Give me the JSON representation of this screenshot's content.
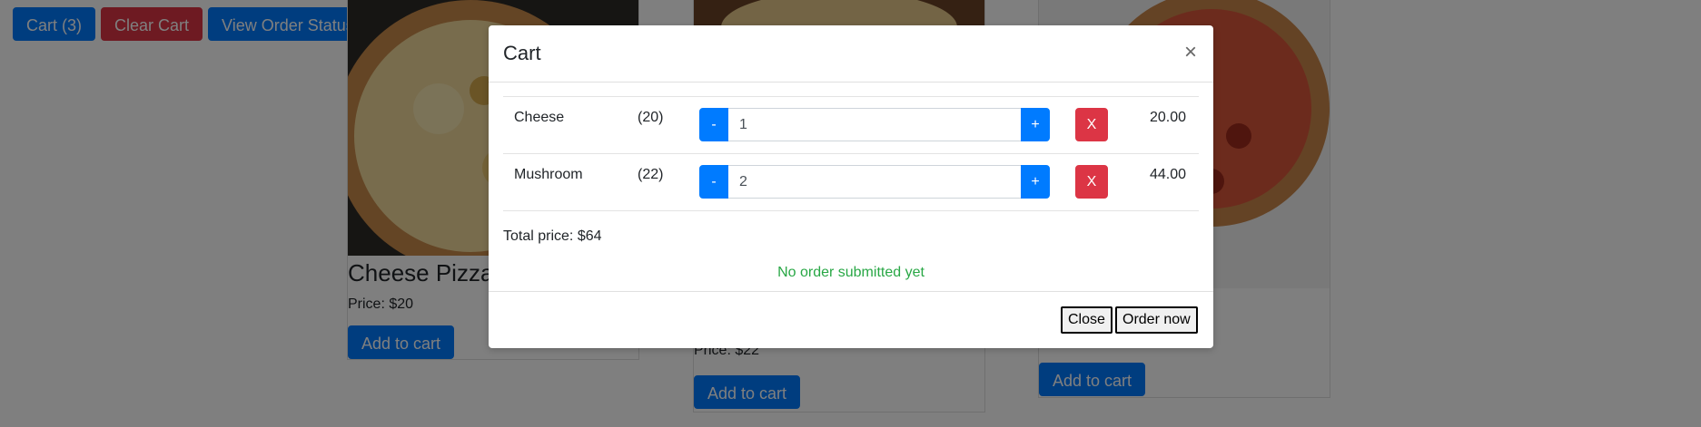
{
  "toolbar": {
    "cart_label": "Cart (3)",
    "clear_label": "Clear Cart",
    "status_label": "View Order Status"
  },
  "products": [
    {
      "title": "Cheese Pizza",
      "price": "Price: $20",
      "button": "Add to cart"
    },
    {
      "title": "",
      "price": "Price: $22",
      "button": "Add to cart"
    },
    {
      "title": "",
      "price": "",
      "button": "Add to cart"
    }
  ],
  "modal": {
    "title": "Cart",
    "close_glyph": "×",
    "items": [
      {
        "name": "Cheese",
        "unit_price": "(20)",
        "quantity": "1",
        "minus": "-",
        "plus": "+",
        "remove": "X",
        "line_total": "20.00"
      },
      {
        "name": "Mushroom",
        "unit_price": "(22)",
        "quantity": "2",
        "minus": "-",
        "plus": "+",
        "remove": "X",
        "line_total": "44.00"
      }
    ],
    "total_price": "Total price: $64",
    "order_status": "No order submitted yet",
    "close_button": "Close",
    "order_button": "Order now"
  },
  "colors": {
    "primary": "#007bff",
    "danger": "#dc3545",
    "success_text": "#28a745",
    "backdrop": "rgba(0,0,0,0.5)"
  },
  "icons": {
    "modal_close": "close-icon"
  }
}
